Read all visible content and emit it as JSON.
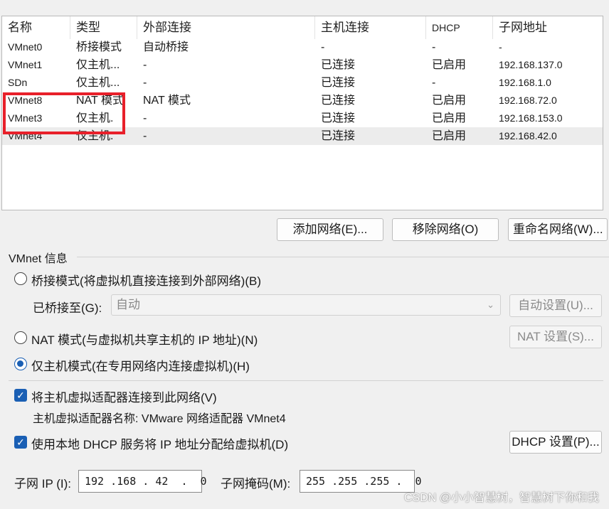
{
  "table": {
    "headers": [
      "名称",
      "类型",
      "外部连接",
      "主机连接",
      "DHCP",
      "子网地址"
    ],
    "rows": [
      {
        "name": "VMnet0",
        "type": "桥接模式",
        "external": "自动桥接",
        "host": "-",
        "dhcp": "-",
        "subnet": "-"
      },
      {
        "name": "VMnet1",
        "type": "仅主机...",
        "external": "-",
        "host": "已连接",
        "dhcp": "已启用",
        "subnet": "192.168.137.0"
      },
      {
        "name": "SDn",
        "type": "仅主机...",
        "external": "-",
        "host": "已连接",
        "dhcp": "-",
        "subnet": "192.168.1.0"
      },
      {
        "name": "VMnet8",
        "type": "NAT 模式",
        "external": "NAT 模式",
        "host": "已连接",
        "dhcp": "已启用",
        "subnet": "192.168.72.0"
      },
      {
        "name": "VMnet3",
        "type": "仅主机.",
        "external": "-",
        "host": "已连接",
        "dhcp": "已启用",
        "subnet": "192.168.153.0"
      },
      {
        "name": "VMnet4",
        "type": "仅主机.",
        "external": "-",
        "host": "已连接",
        "dhcp": "已启用",
        "subnet": "192.168.42.0"
      }
    ],
    "selected_row": "VMnet4",
    "highlight_color": "#e8202a"
  },
  "buttons": {
    "add_network": "添加网络(E)...",
    "remove_network": "移除网络(O)",
    "rename_network": "重命名网络(W)..."
  },
  "vmnet_info": {
    "title": "VMnet 信息",
    "bridged_label": "桥接模式(将虚拟机直接连接到外部网络)(B)",
    "bridged_to_label": "已桥接至(G):",
    "bridged_to_value": "自动",
    "auto_settings_button": "自动设置(U)...",
    "nat_label": "NAT 模式(与虚拟机共享主机的 IP 地址)(N)",
    "nat_settings_button": "NAT 设置(S)...",
    "host_only_label": "仅主机模式(在专用网络内连接虚拟机)(H)",
    "selected_mode": "host_only",
    "connect_adapter_label": "将主机虚拟适配器连接到此网络(V)",
    "connect_adapter_checked": true,
    "adapter_name_text": "主机虚拟适配器名称: VMware 网络适配器 VMnet4",
    "dhcp_label": "使用本地 DHCP 服务将 IP 地址分配给虚拟机(D)",
    "dhcp_checked": true,
    "dhcp_settings_button": "DHCP 设置(P)...",
    "subnet_ip_label": "子网 IP (I):",
    "subnet_ip_value": "192 .168 . 42  .  0",
    "subnet_mask_label": "子网掩码(M):",
    "subnet_mask_value": "255 .255 .255 .  0",
    "accent_color": "#1a5fb4"
  },
  "watermark": "CSDN @小小智慧树，智慧树下你和我"
}
